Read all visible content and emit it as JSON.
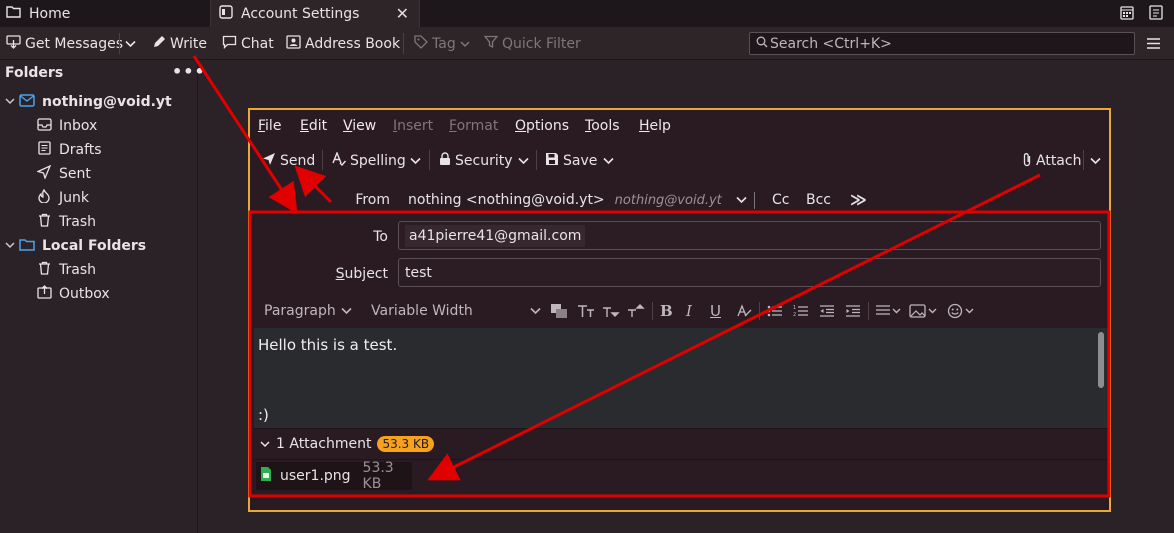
{
  "tabs": {
    "home_label": "Home",
    "settings_label": "Account Settings",
    "close_glyph": "✕"
  },
  "toolbar": {
    "get_messages": "Get Messages",
    "write": "Write",
    "chat": "Chat",
    "address_book": "Address Book",
    "tag": "Tag",
    "quick_filter": "Quick Filter",
    "search_placeholder": "Search <Ctrl+K>"
  },
  "folders": {
    "header": "Folders",
    "more_glyph": "•••",
    "account": "nothing@void.yt",
    "inbox": "Inbox",
    "drafts": "Drafts",
    "sent": "Sent",
    "junk": "Junk",
    "trash": "Trash",
    "local_folders": "Local Folders",
    "local_trash": "Trash",
    "outbox": "Outbox"
  },
  "compose": {
    "menu": {
      "file_u": "F",
      "file_r": "ile",
      "edit_u": "E",
      "edit_r": "dit",
      "view_u": "V",
      "view_r": "iew",
      "insert_u": "I",
      "insert_r": "nsert",
      "format_u": "F",
      "format_r": "ormat",
      "options_u": "O",
      "options_r": "ptions",
      "tools_u": "T",
      "tools_r": "ools",
      "help_u": "H",
      "help_r": "elp"
    },
    "send": "Send",
    "spelling": "Spelling",
    "security": "Security",
    "save": "Save",
    "attach": "Attach",
    "from_label": "From",
    "from_value": "nothing <nothing@void.yt>",
    "from_identity": "nothing@void.yt",
    "cc": "Cc",
    "bcc": "Bcc",
    "more_glyph": "≫",
    "to_label": "To",
    "to_value": "a41pierre41@gmail.com",
    "subject_label_u": "S",
    "subject_label_r": "ubject",
    "subject_value": "test",
    "paragraph": "Paragraph",
    "font": "Variable Width",
    "body_line1": "Hello this is a test.",
    "body_line2": ":)",
    "attachment_count": "1 Attachment",
    "attachment_total": "53.3 KB",
    "attachment_name": "user1.png",
    "attachment_size": "53.3 KB"
  },
  "colors": {
    "window_border": "#e8a93a",
    "highlight": "#e00000",
    "badge": "#f6a21e"
  }
}
